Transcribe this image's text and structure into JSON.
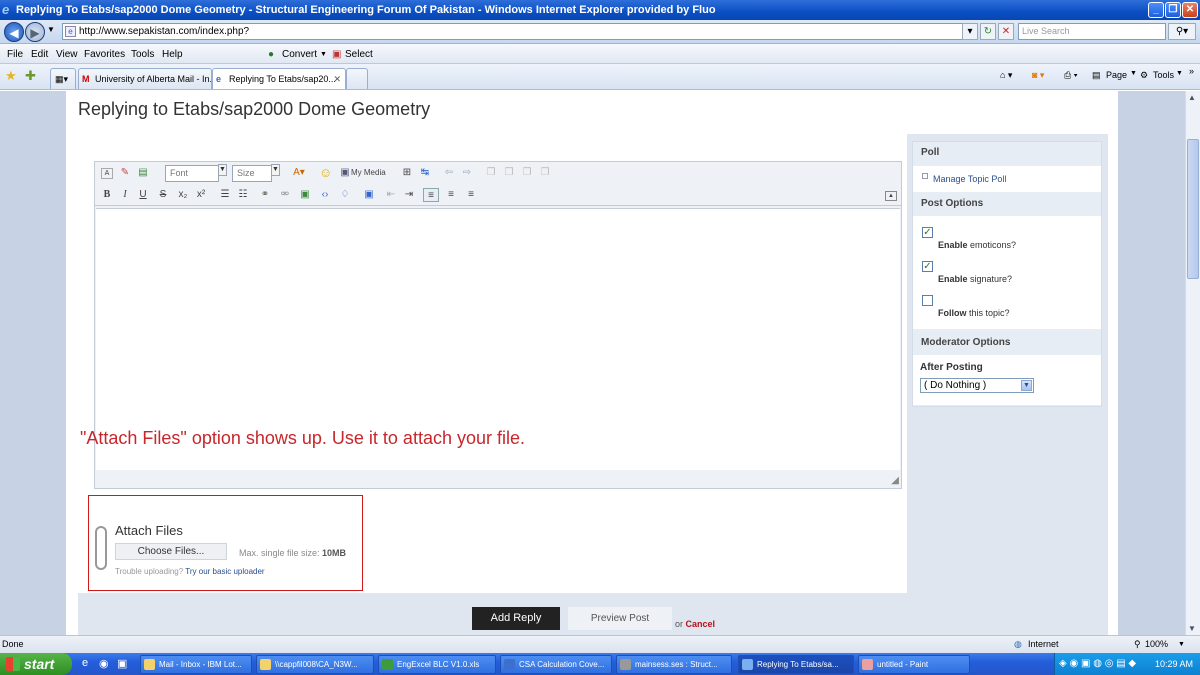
{
  "window": {
    "title": "Replying To Etabs/sap2000 Dome Geometry - Structural Engineering Forum Of Pakistan - Windows Internet Explorer provided by Fluo"
  },
  "address": {
    "url": "http://www.sepakistan.com/index.php?",
    "search_placeholder": "Live Search"
  },
  "menu": [
    "File",
    "Edit",
    "View",
    "Favorites",
    "Tools",
    "Help"
  ],
  "menu_extra": {
    "convert": "Convert",
    "select": "Select"
  },
  "tabs": [
    {
      "label": "University of Alberta Mail - In..."
    },
    {
      "label": "Replying To Etabs/sap20..."
    }
  ],
  "tab_tools": {
    "page": "Page",
    "tools": "Tools"
  },
  "page": {
    "heading": "Replying to Etabs/sap2000 Dome Geometry"
  },
  "editor": {
    "font_label": "Font",
    "size_label": "Size",
    "my_media": "My Media"
  },
  "annotation": "\"Attach Files\" option shows up. Use it to attach your file.",
  "sidebar": {
    "poll_title": "Poll",
    "manage_poll": "Manage Topic Poll",
    "post_options_title": "Post Options",
    "opt_emoticons_b": "Enable",
    "opt_emoticons": "emoticons?",
    "opt_signature_b": "Enable",
    "opt_signature": "signature?",
    "opt_follow_b": "Follow",
    "opt_follow": "this topic?",
    "moderator_title": "Moderator Options",
    "after_posting": "After Posting",
    "after_posting_value": "( Do Nothing )"
  },
  "attach": {
    "title": "Attach Files",
    "choose": "Choose Files...",
    "max_label": "Max. single file size:",
    "max_value": "10MB",
    "trouble": "Trouble uploading?",
    "basic": "Try our basic uploader"
  },
  "actions": {
    "add_reply": "Add Reply",
    "preview": "Preview Post",
    "or": "or",
    "cancel": "Cancel"
  },
  "status": {
    "left": "Done",
    "zone": "Internet",
    "zoom": "100%"
  },
  "taskbar": {
    "start": "start",
    "tasks": [
      "Mail - Inbox - IBM Lot...",
      "\\\\cappfil008\\CA_N3W...",
      "EngExcel BLC V1.0.xls",
      "CSA Calculation Cove...",
      "mainsess.ses : Struct...",
      "Replying To Etabs/sa...",
      "untitled - Paint"
    ],
    "clock": "10:29 AM"
  }
}
